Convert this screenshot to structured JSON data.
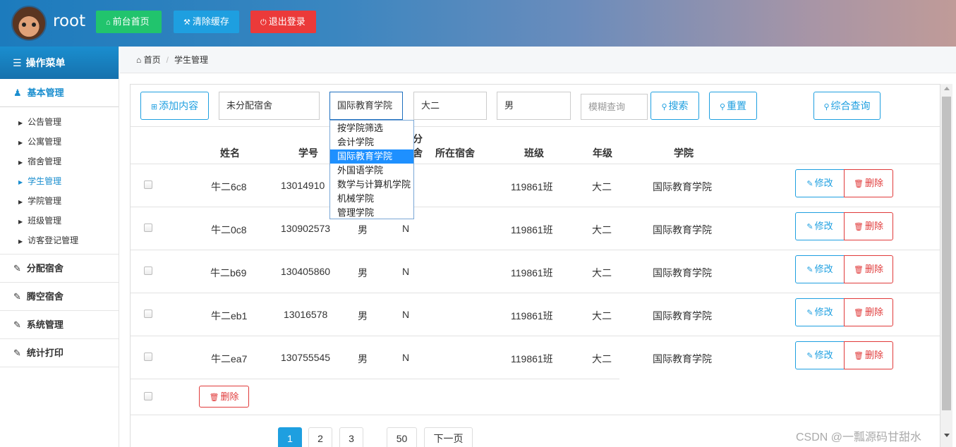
{
  "header": {
    "brand": "root",
    "home_label": "前台首页",
    "cache_label": "清除缓存",
    "logout_label": "退出登录"
  },
  "sidebar": {
    "menu_title": "操作菜单",
    "group_basic": "基本管理",
    "sub_items": [
      "公告管理",
      "公寓管理",
      "宿舍管理",
      "学生管理",
      "学院管理",
      "班级管理",
      "访客登记管理"
    ],
    "group_assign": "分配宿舍",
    "group_vacate": "腾空宿舍",
    "group_system": "系统管理",
    "group_print": "统计打印"
  },
  "breadcrumb": {
    "home": "首页",
    "current": "学生管理"
  },
  "toolbar": {
    "add_label": "添加内容",
    "dorm_filter": "未分配宿舍",
    "college_filter": "国际教育学院",
    "grade_filter": "大二",
    "gender_filter": "男",
    "fuzzy_placeholder": "模糊查询",
    "search_label": "搜索",
    "reset_label": "重置",
    "combo_label": "综合查询"
  },
  "college_options": [
    "按学院筛选",
    "会计学院",
    "国际教育学院",
    "外国语学院",
    "数学与计算机学院",
    "机械学院",
    "管理学院"
  ],
  "table": {
    "headers": {
      "name": "姓名",
      "sid": "学号",
      "assigned_top": "分",
      "assigned_bottom": "舍",
      "dorm": "所在宿舍",
      "class": "班级",
      "grade": "年级",
      "college": "学院"
    },
    "rows": [
      {
        "name": "牛二6c8",
        "sid": "13014910",
        "gender": "",
        "assigned": "",
        "class": "119861班",
        "grade": "大二",
        "college": "国际教育学院"
      },
      {
        "name": "牛二0c8",
        "sid": "130902573",
        "gender": "男",
        "assigned": "N",
        "class": "119861班",
        "grade": "大二",
        "college": "国际教育学院"
      },
      {
        "name": "牛二b69",
        "sid": "130405860",
        "gender": "男",
        "assigned": "N",
        "class": "119861班",
        "grade": "大二",
        "college": "国际教育学院"
      },
      {
        "name": "牛二eb1",
        "sid": "13016578",
        "gender": "男",
        "assigned": "N",
        "class": "119861班",
        "grade": "大二",
        "college": "国际教育学院"
      },
      {
        "name": "牛二ea7",
        "sid": "130755545",
        "gender": "男",
        "assigned": "N",
        "class": "119861班",
        "grade": "大二",
        "college": "国际教育学院"
      }
    ],
    "edit_label": "修改",
    "delete_label": "删除",
    "bulk_delete_label": "删除"
  },
  "pagination": {
    "pages": [
      "1",
      "2",
      "3"
    ],
    "last": "50",
    "next": "下一页"
  },
  "watermark": "CSDN @一瓢源码甘甜水",
  "colors": {
    "accent": "#1e9fe0",
    "danger": "#e03a3a",
    "success": "#21c46d"
  }
}
